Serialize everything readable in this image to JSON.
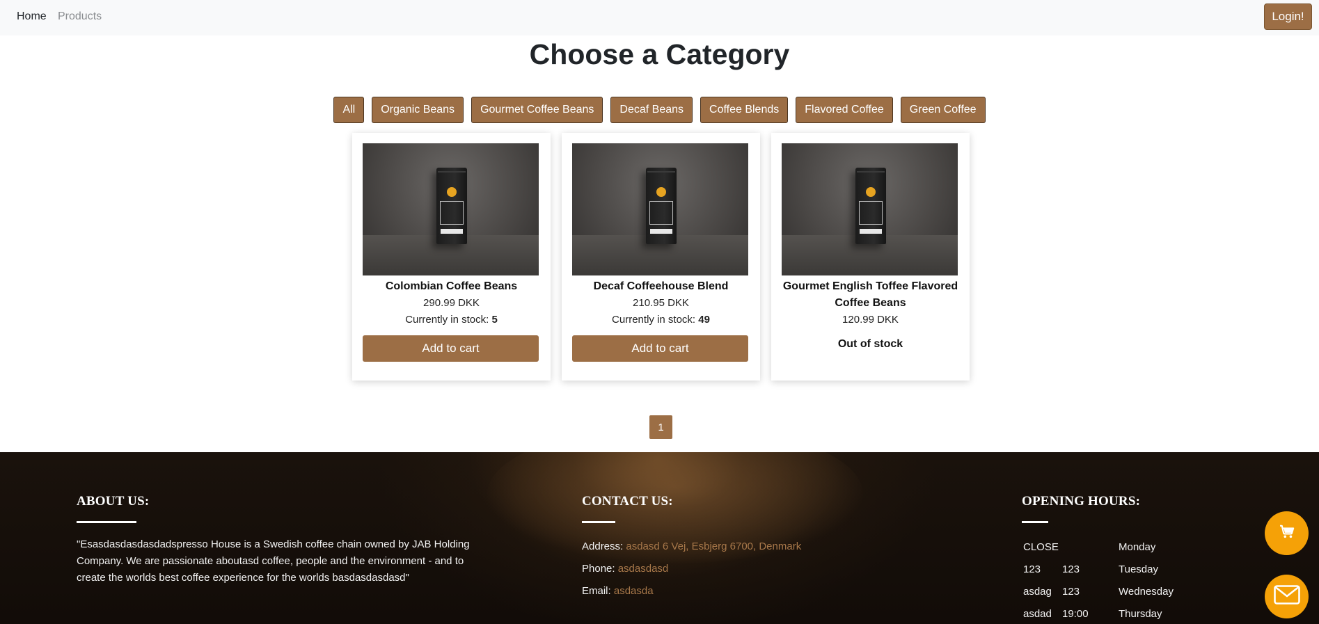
{
  "navbar": {
    "home": "Home",
    "products": "Products",
    "login": "Login!"
  },
  "page_title": "Choose a Category",
  "categories": [
    "All",
    "Organic Beans",
    "Gourmet Coffee Beans",
    "Decaf Beans",
    "Coffee Blends",
    "Flavored Coffee",
    "Green Coffee"
  ],
  "products": [
    {
      "name": "Colombian Coffee Beans",
      "price": "290.99 DKK",
      "stock_label": "Currently in stock:",
      "stock": "5",
      "action": "Add to cart"
    },
    {
      "name": "Decaf Coffeehouse Blend",
      "price": "210.95 DKK",
      "stock_label": "Currently in stock:",
      "stock": "49",
      "action": "Add to cart"
    },
    {
      "name": "Gourmet English Toffee Flavored Coffee Beans",
      "price": "120.99 DKK",
      "status": "Out of stock"
    }
  ],
  "pagination": {
    "current": "1"
  },
  "footer": {
    "about": {
      "heading": "ABOUT US:",
      "text": "\"Esasdasdasdasdadspresso House is a Swedish coffee chain owned by JAB Holding Company. We are passionate aboutasd coffee, people and the environment - and to create the worlds best coffee experience for the worlds basdasdasdasd\""
    },
    "contact": {
      "heading": "CONTACT US:",
      "address_label": "Address:",
      "address": "asdasd 6 Vej, Esbjerg 6700, Denmark",
      "phone_label": "Phone:",
      "phone": "asdasdasd",
      "email_label": "Email:",
      "email": "asdasda"
    },
    "hours": {
      "heading": "OPENING HOURS:",
      "rows": [
        {
          "open": "CLOSE",
          "close": "",
          "day": "Monday"
        },
        {
          "open": "123",
          "close": "123",
          "day": "Tuesday"
        },
        {
          "open": "asdag",
          "close": "123",
          "day": "Wednesday"
        },
        {
          "open": "asdad",
          "close": "19:00",
          "day": "Thursday"
        }
      ]
    }
  },
  "icons": {
    "cart": "cart-icon",
    "mail": "mail-icon"
  },
  "colors": {
    "accent": "#9c6e45",
    "fab": "#f5a107",
    "footer_link": "#a8784a"
  }
}
